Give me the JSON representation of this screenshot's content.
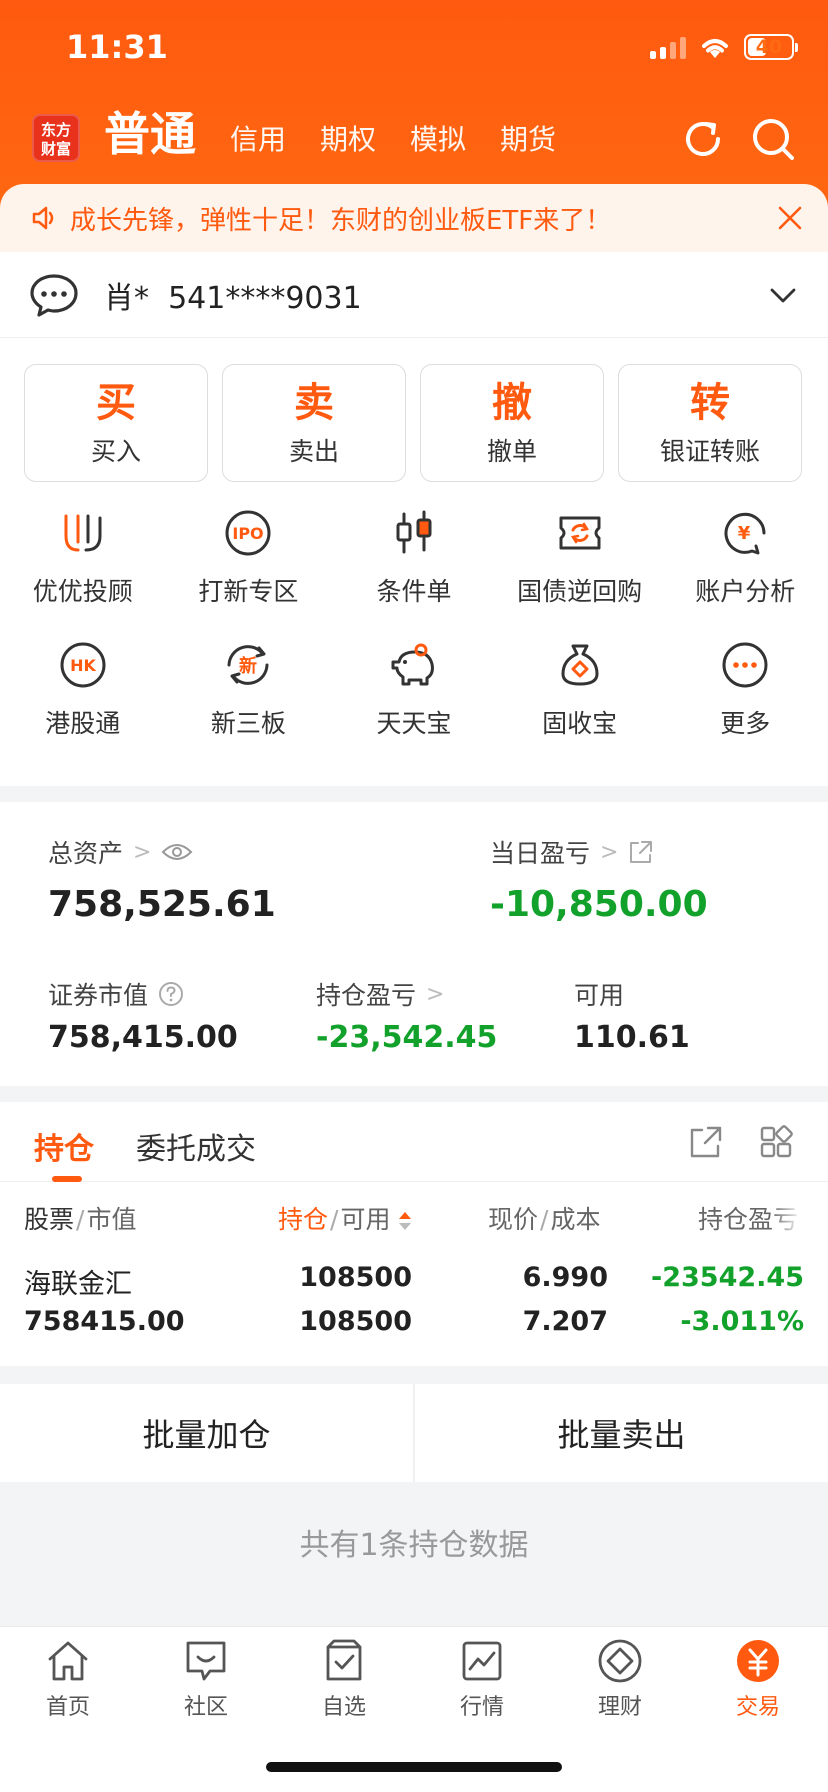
{
  "status_bar": {
    "time": "11:31",
    "battery": "40"
  },
  "header": {
    "logo": "东方\n财富",
    "active_mode": "普通",
    "modes": [
      "信用",
      "期权",
      "模拟",
      "期货"
    ]
  },
  "banner": {
    "text": "成长先锋，弹性十足！东财的创业板ETF来了！"
  },
  "account": {
    "name": "肖*  541****9031"
  },
  "trade_buttons": [
    {
      "char": "买",
      "label": "买入"
    },
    {
      "char": "卖",
      "label": "卖出"
    },
    {
      "char": "撤",
      "label": "撤单"
    },
    {
      "char": "转",
      "label": "银证转账"
    }
  ],
  "features": [
    {
      "label": "优优投顾",
      "icon": "youyou-icon"
    },
    {
      "label": "打新专区",
      "icon": "ipo-icon",
      "icon_text": "IPO"
    },
    {
      "label": "条件单",
      "icon": "candlestick-icon"
    },
    {
      "label": "国债逆回购",
      "icon": "repo-icon"
    },
    {
      "label": "账户分析",
      "icon": "account-analysis-icon",
      "icon_text": "¥"
    },
    {
      "label": "港股通",
      "icon": "hk-icon",
      "icon_text": "HK"
    },
    {
      "label": "新三板",
      "icon": "new-board-icon",
      "icon_text": "新"
    },
    {
      "label": "天天宝",
      "icon": "piggy-bank-icon"
    },
    {
      "label": "固收宝",
      "icon": "money-bag-icon"
    },
    {
      "label": "更多",
      "icon": "more-icon"
    }
  ],
  "assets": {
    "total_label": "总资产",
    "total_value": "758,525.61",
    "daily_pl_label": "当日盈亏",
    "daily_pl_value": "-10,850.00",
    "market_value_label": "证券市值",
    "market_value": "758,415.00",
    "position_pl_label": "持仓盈亏",
    "position_pl_value": "-23,542.45",
    "available_label": "可用",
    "available_value": "110.61"
  },
  "holdings": {
    "tabs": [
      "持仓",
      "委托成交"
    ],
    "columns": {
      "stock": "股票",
      "market_value": "市值",
      "position": "持仓",
      "available": "可用",
      "price": "现价",
      "cost": "成本",
      "pl": "持仓盈亏"
    },
    "rows": [
      {
        "name": "海联金汇",
        "market_value": "758415.00",
        "position": "108500",
        "available": "108500",
        "price": "6.990",
        "cost": "7.207",
        "pl": "-23542.45",
        "pl_pct": "-3.011%"
      }
    ],
    "batch_add": "批量加仓",
    "batch_sell": "批量卖出",
    "summary": "共有1条持仓数据"
  },
  "bottom_nav": [
    {
      "label": "首页",
      "icon": "home-icon"
    },
    {
      "label": "社区",
      "icon": "community-icon"
    },
    {
      "label": "自选",
      "icon": "watchlist-icon"
    },
    {
      "label": "行情",
      "icon": "market-icon"
    },
    {
      "label": "理财",
      "icon": "wealth-icon"
    },
    {
      "label": "交易",
      "icon": "trade-icon",
      "active": true
    }
  ],
  "colors": {
    "brand": "#ff5a0f",
    "loss": "#12a12a"
  }
}
